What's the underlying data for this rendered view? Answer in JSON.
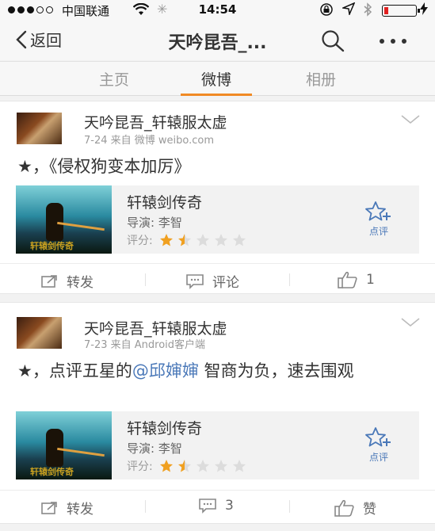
{
  "status": {
    "carrier": "中国联通",
    "time": "14:54"
  },
  "nav": {
    "back_label": "返回",
    "title": "天吟昆吾_..."
  },
  "tabs": [
    {
      "label": "主页"
    },
    {
      "label": "微博"
    },
    {
      "label": "相册"
    }
  ],
  "posts": [
    {
      "username": "天吟昆吾_轩辕服太虚",
      "meta": "7-24  来自 微博 weibo.com",
      "text_prefix": "★，《侵权狗变本加厉》",
      "mention": "",
      "text_suffix": "",
      "film": {
        "title": "轩辕剑传奇",
        "director": "导演: 李智",
        "rating_label": "评分:",
        "rating_stars": 1.5,
        "rate_button": "点评",
        "poster_caption": "轩辕剑传奇"
      },
      "actions": {
        "repost": "转发",
        "comment": "评论",
        "like": "1"
      }
    },
    {
      "username": "天吟昆吾_轩辕服太虚",
      "meta": "7-23  来自 Android客户端",
      "text_prefix": "★，点评五星的",
      "mention": "@邱婶婶",
      "text_suffix": " 智商为负，速去围观",
      "film": {
        "title": "轩辕剑传奇",
        "director": "导演: 李智",
        "rating_label": "评分:",
        "rating_stars": 1.5,
        "rate_button": "点评",
        "poster_caption": "轩辕剑传奇"
      },
      "actions": {
        "repost": "转发",
        "comment": "3",
        "like": "赞"
      }
    }
  ],
  "colors": {
    "accent": "#f08a24",
    "link": "#4a78b8",
    "star": "#f0a020"
  }
}
